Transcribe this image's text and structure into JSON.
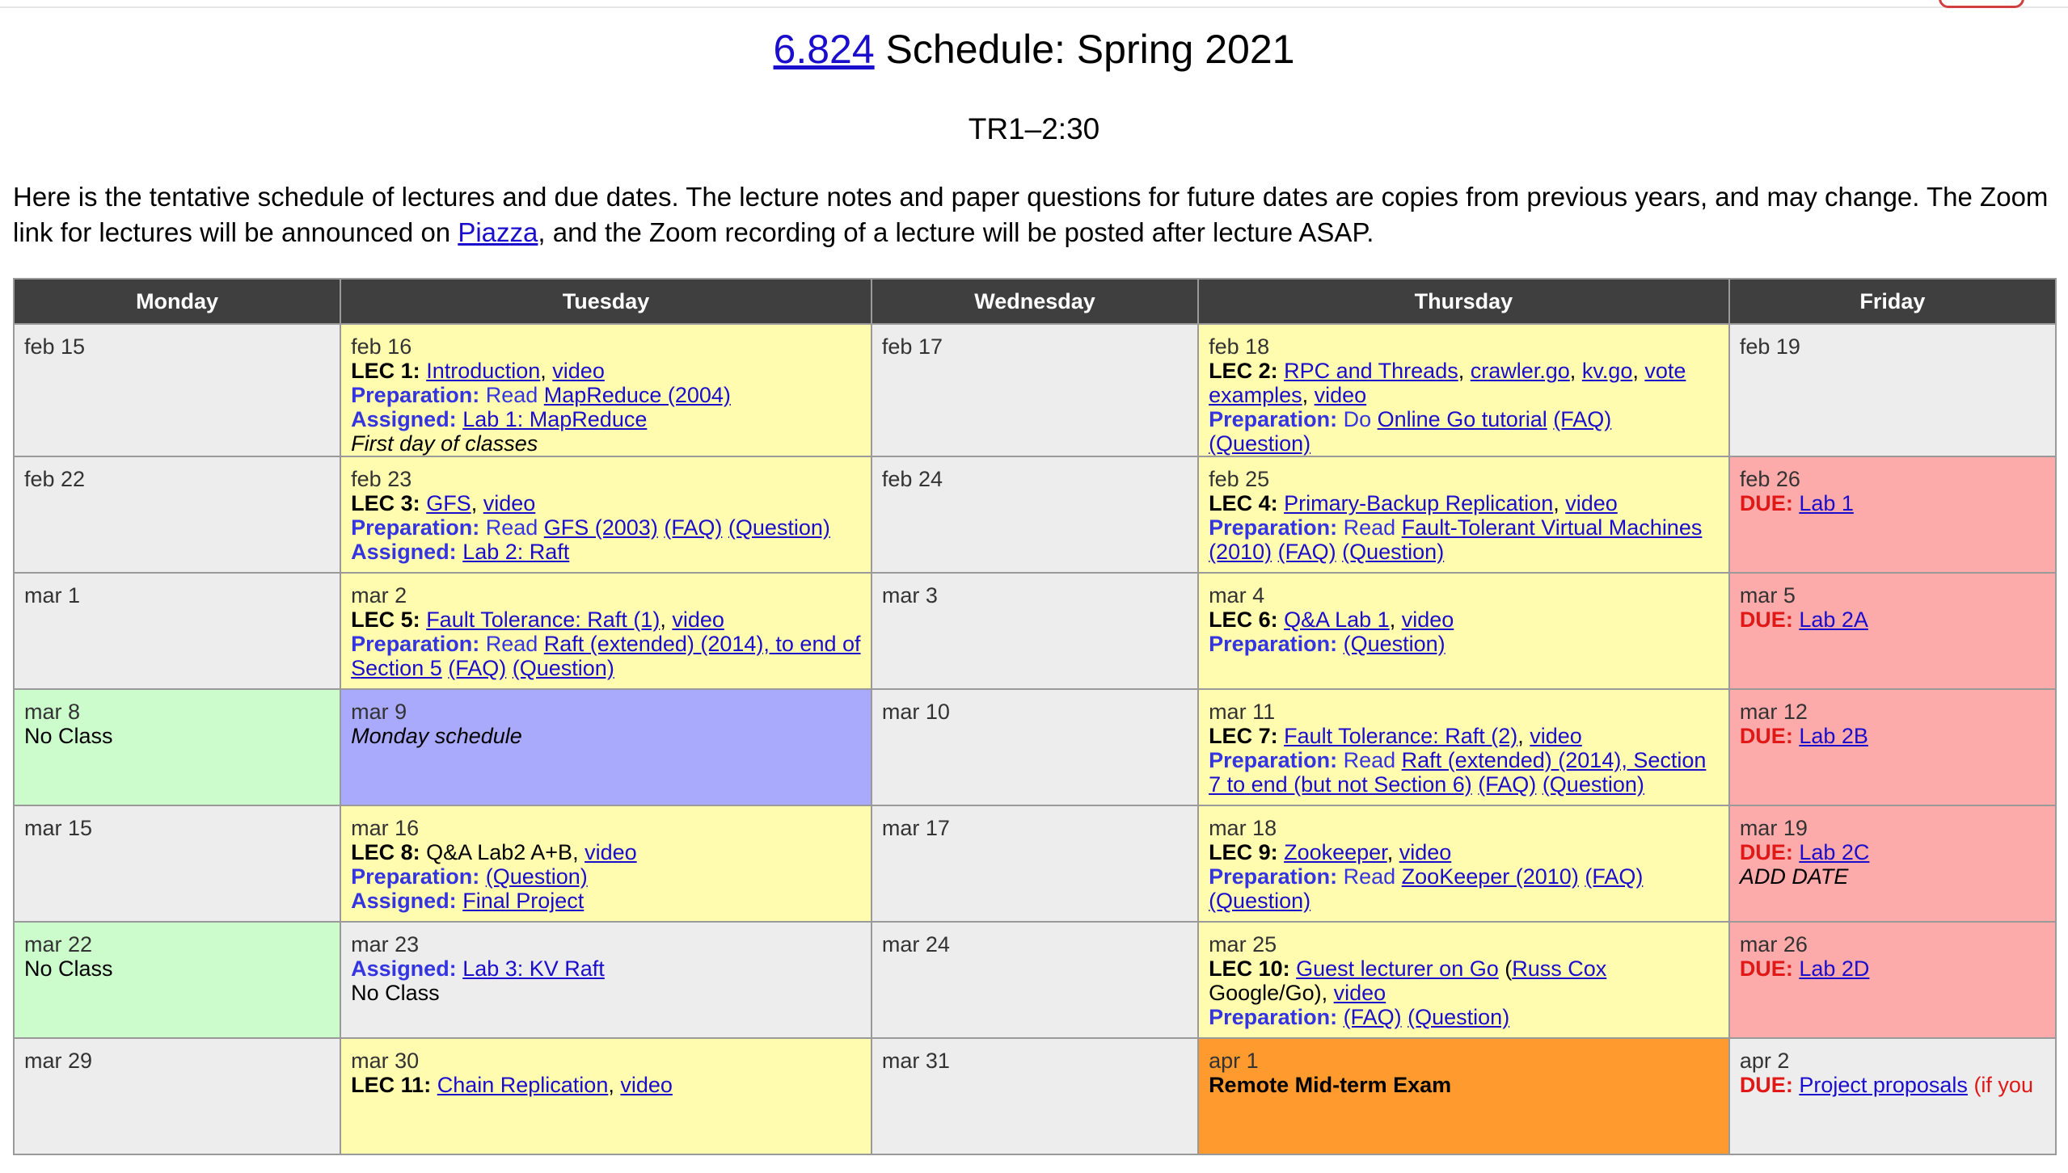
{
  "header": {
    "course_link": "6.824",
    "title_rest": " Schedule: Spring 2021",
    "subtitle": "TR1–2:30"
  },
  "intro": {
    "part1": "Here is the tentative schedule of lectures and due dates. The lecture notes and paper questions for future dates are copies from previous years, and may change. The Zoom link for lectures will be announced on ",
    "piazza": "Piazza",
    "part2": ", and the Zoom recording of a lecture will be posted after lecture ASAP."
  },
  "colors": {
    "grey": "#ededed",
    "yellow": "#fffcb0",
    "red": "#fdaaaa",
    "green": "#ccfccc",
    "purple": "#aaaafc",
    "orange": "#fe9a2e",
    "header": "#3f3f3f",
    "link": "#1a0dcc",
    "label": "#3434e0",
    "due": "#e01818"
  },
  "table": {
    "headers": [
      "Monday",
      "Tuesday",
      "Wednesday",
      "Thursday",
      "Friday"
    ],
    "r1": {
      "mon": {
        "date": "feb 15"
      },
      "tue": {
        "date": "feb 16",
        "lec": "LEC 1:",
        "lec_link1": "Introduction",
        "sep1": ", ",
        "video": "video",
        "prep_label": "Preparation:",
        "prep_text": " Read ",
        "prep_link": "MapReduce (2004)",
        "assigned_label": "Assigned:",
        "assigned_link": "Lab 1: MapReduce",
        "note": "First day of classes"
      },
      "wed": {
        "date": "feb 17"
      },
      "thu": {
        "date": "feb 18",
        "lec": "LEC 2:",
        "link1": "RPC and Threads",
        "sep1": ", ",
        "link2": "crawler.go",
        "sep2": ", ",
        "link3": "kv.go",
        "sep3": ", ",
        "link4": "vote examples",
        "sep4": ", ",
        "video": "video",
        "prep_label": "Preparation:",
        "prep_text": " Do ",
        "prep_link": "Online Go tutorial",
        "faq": "(FAQ)",
        "question": "(Question)"
      },
      "fri": {
        "date": "feb 19"
      }
    },
    "r2": {
      "mon": {
        "date": "feb 22"
      },
      "tue": {
        "date": "feb 23",
        "lec": "LEC 3:",
        "link1": "GFS",
        "sep1": ", ",
        "video": "video",
        "prep_label": "Preparation:",
        "prep_text": " Read ",
        "prep_link": "GFS (2003)",
        "faq": "(FAQ)",
        "question": "(Question)",
        "assigned_label": "Assigned:",
        "assigned_link": "Lab 2: Raft"
      },
      "wed": {
        "date": "feb 24"
      },
      "thu": {
        "date": "feb 25",
        "lec": "LEC 4:",
        "link1": "Primary-Backup Replication",
        "sep1": ", ",
        "video": "video",
        "prep_label": "Preparation:",
        "prep_text": " Read ",
        "prep_link": "Fault-Tolerant Virtual Machines (2010)",
        "faq": "(FAQ)",
        "question": "(Question)"
      },
      "fri": {
        "date": "feb 26",
        "due_label": "DUE:",
        "due_link": "Lab 1"
      }
    },
    "r3": {
      "mon": {
        "date": "mar 1"
      },
      "tue": {
        "date": "mar 2",
        "lec": "LEC 5:",
        "link1": "Fault Tolerance: Raft (1)",
        "sep1": ", ",
        "video": "video",
        "prep_label": "Preparation:",
        "prep_text": " Read ",
        "prep_link": "Raft (extended) (2014), to end of Section 5",
        "faq": "(FAQ)",
        "question": "(Question)"
      },
      "wed": {
        "date": "mar 3"
      },
      "thu": {
        "date": "mar 4",
        "lec": "LEC 6:",
        "link1": "Q&A Lab 1",
        "sep1": ", ",
        "video": "video",
        "prep_label": "Preparation:",
        "question": "(Question)"
      },
      "fri": {
        "date": "mar 5",
        "due_label": "DUE:",
        "due_link": "Lab 2A"
      }
    },
    "r4": {
      "mon": {
        "date": "mar 8",
        "note": "No Class"
      },
      "tue": {
        "date": "mar 9",
        "note": "Monday schedule"
      },
      "wed": {
        "date": "mar 10"
      },
      "thu": {
        "date": "mar 11",
        "lec": "LEC 7:",
        "link1": "Fault Tolerance: Raft (2)",
        "sep1": ", ",
        "video": "video",
        "prep_label": "Preparation:",
        "prep_text": " Read ",
        "prep_link": "Raft (extended) (2014), Section 7 to end (but not Section 6)",
        "faq": "(FAQ)",
        "question": "(Question)"
      },
      "fri": {
        "date": "mar 12",
        "due_label": "DUE:",
        "due_link": "Lab 2B"
      }
    },
    "r5": {
      "mon": {
        "date": "mar 15"
      },
      "tue": {
        "date": "mar 16",
        "lec": "LEC 8:",
        "lec_text": " Q&A Lab2 A+B, ",
        "video": "video",
        "prep_label": "Preparation:",
        "question": "(Question)",
        "assigned_label": "Assigned:",
        "assigned_link": "Final Project"
      },
      "wed": {
        "date": "mar 17"
      },
      "thu": {
        "date": "mar 18",
        "lec": "LEC 9:",
        "link1": "Zookeeper",
        "sep1": ", ",
        "video": "video",
        "prep_label": "Preparation:",
        "prep_text": " Read ",
        "prep_link": "ZooKeeper (2010)",
        "faq": "(FAQ)",
        "question": "(Question)"
      },
      "fri": {
        "date": "mar 19",
        "due_label": "DUE:",
        "due_link": "Lab 2C",
        "note": "ADD DATE"
      }
    },
    "r6": {
      "mon": {
        "date": "mar 22",
        "note": "No Class"
      },
      "tue": {
        "date": "mar 23",
        "assigned_label": "Assigned:",
        "assigned_link": "Lab 3: KV Raft",
        "note": "No Class"
      },
      "wed": {
        "date": "mar 24"
      },
      "thu": {
        "date": "mar 25",
        "lec": "LEC 10:",
        "link1": "Guest lecturer on Go",
        "paren_open": " (",
        "link2": "Russ Cox",
        "text2": " Google/Go), ",
        "video": "video",
        "prep_label": "Preparation:",
        "faq": "(FAQ)",
        "question": "(Question)"
      },
      "fri": {
        "date": "mar 26",
        "due_label": "DUE:",
        "due_link": "Lab 2D"
      }
    },
    "r7": {
      "mon": {
        "date": "mar 29"
      },
      "tue": {
        "date": "mar 30",
        "lec": "LEC 11:",
        "link1": "Chain Replication",
        "sep1": ", ",
        "video": "video"
      },
      "wed": {
        "date": "mar 31"
      },
      "thu": {
        "date": "apr 1",
        "note": "Remote Mid-term Exam"
      },
      "fri": {
        "date": "apr 2",
        "due_label": "DUE:",
        "due_link": "Project proposals",
        "red_text": " (if you"
      }
    }
  }
}
